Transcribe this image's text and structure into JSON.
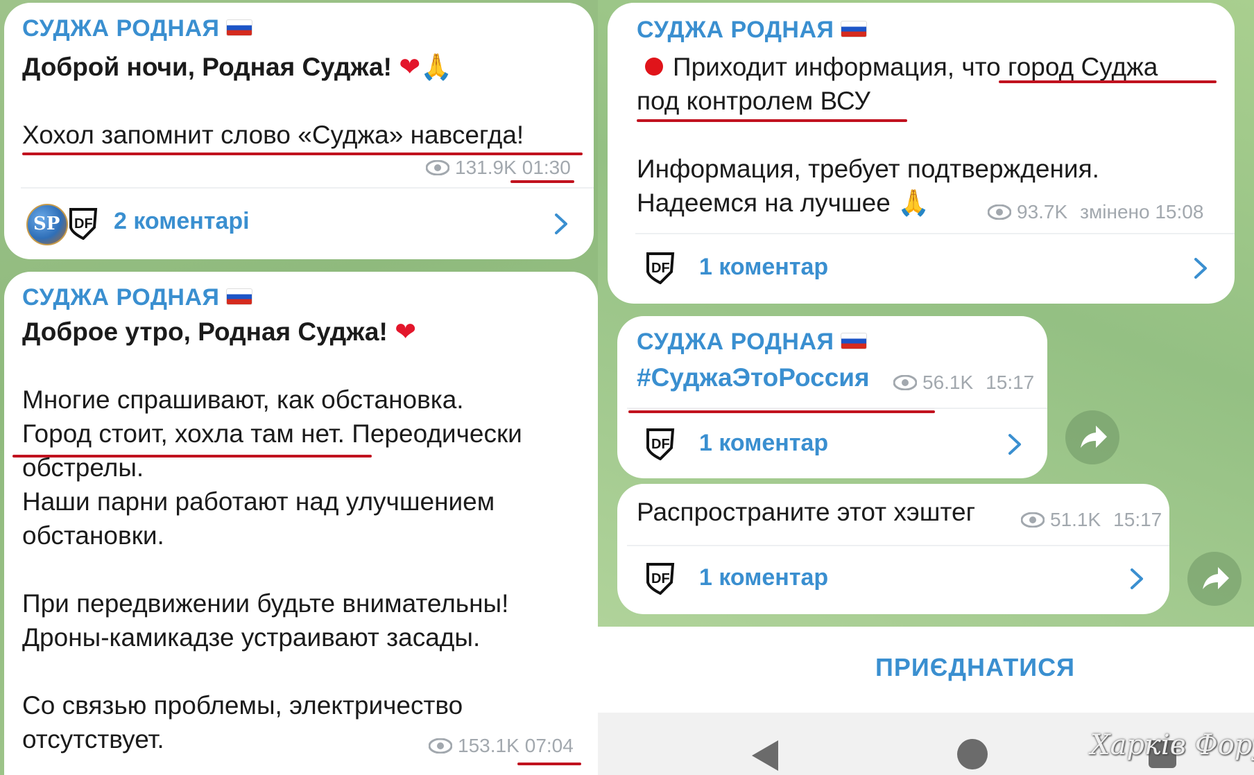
{
  "channel_name": "СУДЖА РОДНАЯ",
  "left": {
    "post1": {
      "greeting": "Доброй ночи, Родная Суджа!",
      "line": "Хохол запомнит слово «Суджа» навсегда!",
      "views": "131.9K",
      "time": "01:30",
      "comments": "2 коментарі"
    },
    "post2": {
      "greeting": "Доброе утро, Родная Суджа!",
      "lines": [
        "Многие спрашивают, как обстановка.",
        "Город стоит, хохла там нет. Переодически",
        "обстрелы.",
        "Наши парни работают над улучшением",
        "обстановки.",
        "При передвижении будьте внимательны!",
        "Дроны-камикадзе устраивают засады.",
        "Со связью проблемы, электричество",
        "отсутствует."
      ],
      "views": "153.1K",
      "time": "07:04"
    }
  },
  "right": {
    "post1": {
      "line1": "Приходит информация, что город Суджа",
      "line2": "под контролем ВСУ",
      "line3": "Информация, требует подтверждения.",
      "line4": "Надеемся на лучшее",
      "views": "93.7K",
      "time": "змінено 15:08",
      "comments": "1 коментар"
    },
    "post2": {
      "hashtag": "#СуджаЭтоРоссия",
      "views": "56.1K",
      "time": "15:17",
      "comments": "1 коментар"
    },
    "post3": {
      "text": "Распространите этот хэштег",
      "views": "51.1K",
      "time": "15:17",
      "comments": "1 коментар"
    },
    "join_label": "ПРИЄДНАТИСЯ"
  },
  "watermark": "Харків Форум",
  "colors": {
    "accent": "#3a8fd0",
    "underline": "#c1121f",
    "chat_bg": "#9ec38a"
  },
  "icons": [
    "eye-icon",
    "chevron-right-icon",
    "df-logo-icon",
    "share-icon",
    "flag-ru-icon",
    "heart-emoji",
    "pray-emoji",
    "red-circle-emoji"
  ]
}
